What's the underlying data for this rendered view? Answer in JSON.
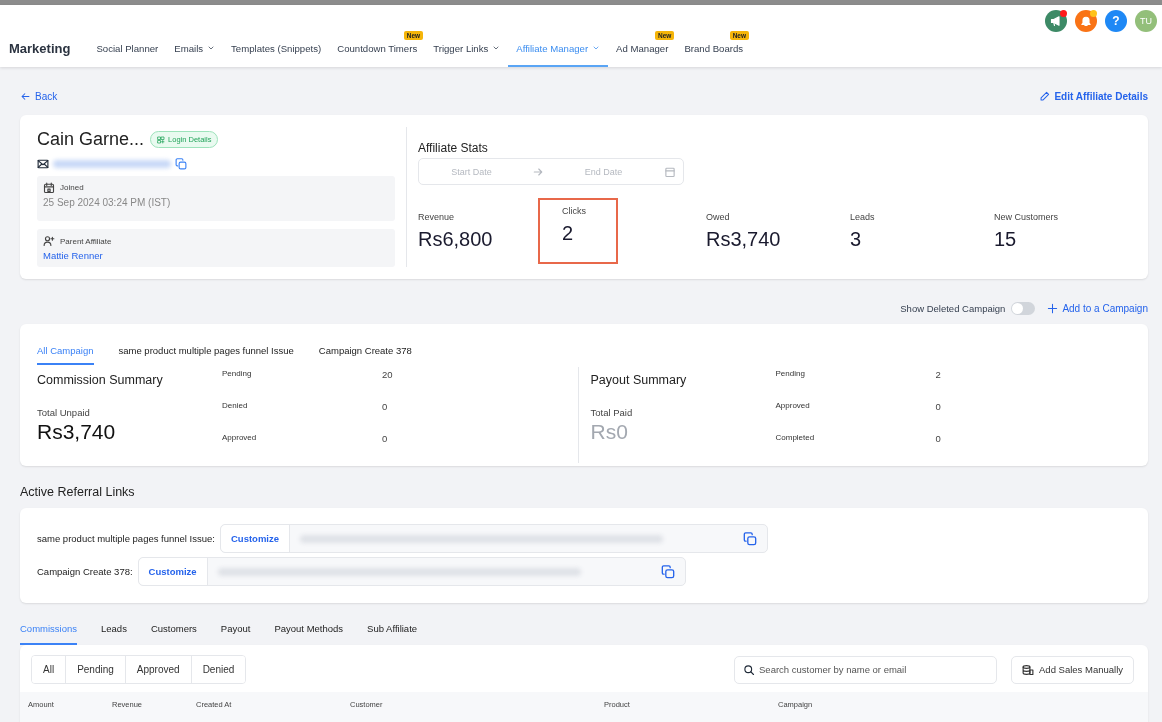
{
  "header": {
    "title": "Marketing",
    "nav": [
      {
        "label": "Social Planner",
        "selected": false,
        "dropdown": false
      },
      {
        "label": "Emails",
        "selected": false,
        "dropdown": true
      },
      {
        "label": "Templates (Snippets)",
        "selected": false,
        "dropdown": false
      },
      {
        "label": "Countdown Timers",
        "selected": false,
        "dropdown": false,
        "badge": "New"
      },
      {
        "label": "Trigger Links",
        "selected": false,
        "dropdown": true
      },
      {
        "label": "Affiliate Manager",
        "selected": true,
        "dropdown": true
      },
      {
        "label": "Ad Manager",
        "selected": false,
        "dropdown": false,
        "badge": "New"
      },
      {
        "label": "Brand Boards",
        "selected": false,
        "dropdown": false,
        "badge": "New"
      }
    ],
    "actions": [
      {
        "kind": "announcements",
        "color": "#ff1a1a"
      },
      {
        "kind": "notifications",
        "color": "#ffc21a"
      },
      {
        "kind": "help",
        "label": "?"
      }
    ],
    "avatar": "TU"
  },
  "back": "Back",
  "edit": "Edit Affiliate Details",
  "profile": {
    "name": "Cain Garne...",
    "login_button": "Login Details",
    "joined_label": "Joined",
    "joined": "25 Sep 2024 03:24 PM (IST)",
    "parent_label": "Parent Affiliate",
    "parent": "Mattie Renner"
  },
  "stats": {
    "title": "Affiliate Stats",
    "start_placeholder": "Start Date",
    "end_placeholder": "End Date",
    "items": [
      {
        "label": "Revenue",
        "value": "Rs6,800",
        "highlighted": false
      },
      {
        "label": "Clicks",
        "value": "2",
        "highlighted": true
      },
      {
        "label": "Owed",
        "value": "Rs3,740",
        "highlighted": false
      },
      {
        "label": "Leads",
        "value": "3",
        "highlighted": false
      },
      {
        "label": "New Customers",
        "value": "15",
        "highlighted": false
      }
    ]
  },
  "show_deleted": {
    "label": "Show Deleted Campaign",
    "on": false
  },
  "add_campaign": "Add to a Campaign",
  "campaign_tabs": [
    {
      "label": "All Campaign",
      "selected": true
    },
    {
      "label": "same product multiple pages funnel Issue",
      "selected": false
    },
    {
      "label": "Campaign Create 378",
      "selected": false
    }
  ],
  "summaries": [
    {
      "title": "Commission Summary",
      "total_label": "Total Unpaid",
      "total": "Rs3,740",
      "muted": false,
      "rows": [
        {
          "label": "Pending",
          "value": "20"
        },
        {
          "label": "Denied",
          "value": "0"
        },
        {
          "label": "Approved",
          "value": "0"
        }
      ]
    },
    {
      "title": "Payout Summary",
      "total_label": "Total Paid",
      "total": "Rs0",
      "muted": true,
      "rows": [
        {
          "label": "Pending",
          "value": "2"
        },
        {
          "label": "Approved",
          "value": "0"
        },
        {
          "label": "Completed",
          "value": "0"
        }
      ]
    }
  ],
  "referral": {
    "title": "Active Referral Links",
    "links": [
      {
        "campaign": "same product multiple pages funnel Issue:",
        "button": "Customize"
      },
      {
        "campaign": "Campaign Create 378:",
        "button": "Customize"
      }
    ]
  },
  "detail_tabs": [
    {
      "label": "Commissions",
      "selected": true
    },
    {
      "label": "Leads",
      "selected": false
    },
    {
      "label": "Customers",
      "selected": false
    },
    {
      "label": "Payout",
      "selected": false
    },
    {
      "label": "Payout Methods",
      "selected": false
    },
    {
      "label": "Sub Affiliate",
      "selected": false
    }
  ],
  "filters": [
    {
      "label": "All",
      "selected": false
    },
    {
      "label": "Pending",
      "selected": false
    },
    {
      "label": "Approved",
      "selected": false
    },
    {
      "label": "Denied",
      "selected": false
    }
  ],
  "search": {
    "placeholder": "Search customer by name or email"
  },
  "add_sales": "Add Sales Manually",
  "columns": [
    "Amount",
    "Revenue",
    "Created At",
    "Customer",
    "Product",
    "Campaign"
  ]
}
